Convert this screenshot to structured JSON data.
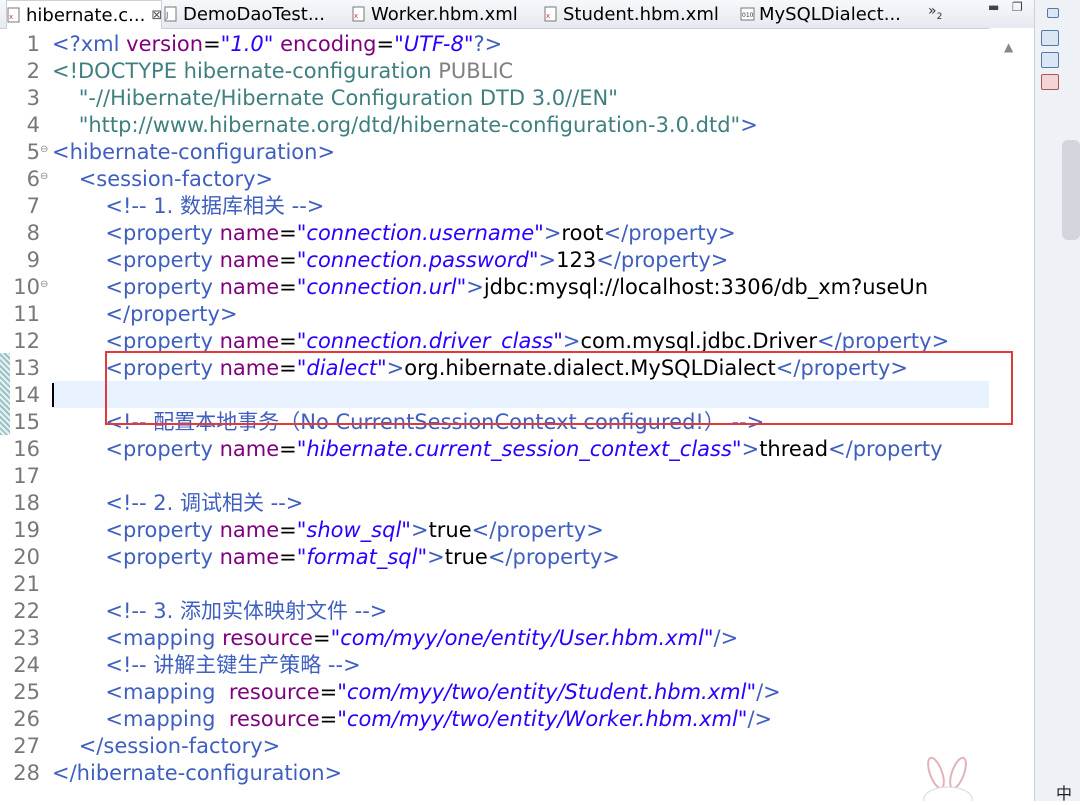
{
  "tabs": [
    {
      "label": "hibernate.c...",
      "close": "⊠",
      "active": true
    },
    {
      "label": "DemoDaoTest...",
      "active": false
    },
    {
      "label": "Worker.hbm.xml",
      "active": false
    },
    {
      "label": "Student.hbm.xml",
      "active": false
    },
    {
      "label": "MySQLDialect...",
      "active": false
    }
  ],
  "tab_overflow": "»",
  "tab_overflow_count": "2",
  "line_numbers": [
    "1",
    "2",
    "3",
    "4",
    "5",
    "6",
    "7",
    "8",
    "9",
    "10",
    "11",
    "12",
    "13",
    "14",
    "15",
    "16",
    "17",
    "18",
    "19",
    "20",
    "21",
    "22",
    "23",
    "24",
    "25",
    "26",
    "27",
    "28"
  ],
  "code": {
    "l1": {
      "a": "<?xml ",
      "b": "version",
      "c": "=",
      "d": "\"1.0\"",
      "e": " encoding",
      "f": "=",
      "g": "\"UTF-8\"",
      "h": "?>"
    },
    "l2": {
      "a": "<!DOCTYPE hibernate-configuration ",
      "b": "PUBLIC"
    },
    "l3": {
      "a": "    \"-//Hibernate/Hibernate Configuration DTD 3.0//EN\""
    },
    "l4": {
      "a": "    \"http://www.hibernate.org/dtd/hibernate-configuration-3.0.dtd\"",
      "b": ">"
    },
    "l5": {
      "a": "<hibernate-configuration>"
    },
    "l6": {
      "a": "    <session-factory>"
    },
    "l7": {
      "a": "        <!-- 1. 数据库相关 -->"
    },
    "l8": {
      "open": "        <property ",
      "attr": "name",
      "eq": "=",
      "val": "\"connection.username\"",
      "close": ">",
      "text": "root",
      "end": "</property>"
    },
    "l9": {
      "open": "        <property ",
      "attr": "name",
      "eq": "=",
      "val": "\"connection.password\"",
      "close": ">",
      "text": "123",
      "end": "</property>"
    },
    "l10": {
      "open": "        <property ",
      "attr": "name",
      "eq": "=",
      "val": "\"connection.url\"",
      "close": ">",
      "text": "jdbc:mysql://localhost:3306/db_xm?useUn"
    },
    "l11": {
      "a": "        </property>"
    },
    "l12": {
      "open": "        <property ",
      "attr": "name",
      "eq": "=",
      "val": "\"connection.driver_class\"",
      "close": ">",
      "text": "com.mysql.jdbc.Driver",
      "end": "</property>"
    },
    "l13": {
      "open": "        <property ",
      "attr": "name",
      "eq": "=",
      "val": "\"dialect\"",
      "close": ">",
      "text": "org.hibernate.dialect.MySQLDialect",
      "end": "</property>"
    },
    "l14": {
      "a": ""
    },
    "l15": {
      "a": "        <!-- 配置本地事务（No CurrentSessionContext configured!） -->"
    },
    "l16": {
      "open": "        <property ",
      "attr": "name",
      "eq": "=",
      "val": "\"hibernate.current_session_context_class\"",
      "close": ">",
      "text": "thread",
      "end": "</property"
    },
    "l17": {
      "a": ""
    },
    "l18": {
      "a": "        <!-- 2. 调试相关 -->"
    },
    "l19": {
      "open": "        <property ",
      "attr": "name",
      "eq": "=",
      "val": "\"show_sql\"",
      "close": ">",
      "text": "true",
      "end": "</property>"
    },
    "l20": {
      "open": "        <property ",
      "attr": "name",
      "eq": "=",
      "val": "\"format_sql\"",
      "close": ">",
      "text": "true",
      "end": "</property>"
    },
    "l21": {
      "a": ""
    },
    "l22": {
      "a": "        <!-- 3. 添加实体映射文件 -->"
    },
    "l23": {
      "open": "        <mapping ",
      "attr": "resource",
      "eq": "=",
      "val": "\"com/myy/one/entity/User.hbm.xml\"",
      "close": "/>"
    },
    "l24": {
      "a": "        <!-- 讲解主键生产策略 -->"
    },
    "l25": {
      "open": "        <mapping  ",
      "attr": "resource",
      "eq": "=",
      "val": "\"com/myy/two/entity/Student.hbm.xml\"",
      "close": "/>"
    },
    "l26": {
      "open": "        <mapping  ",
      "attr": "resource",
      "eq": "=",
      "val": "\"com/myy/two/entity/Worker.hbm.xml\"",
      "close": "/>"
    },
    "l27": {
      "a": "    </session-factory>"
    },
    "l28": {
      "a": "</hibernate-configuration>"
    }
  },
  "ime_indicator": "中",
  "colors": {
    "highlight_box": "#e03a3a",
    "current_line": "#e8f2fe",
    "tag": "#3f5fbf",
    "attr": "#7f007f",
    "value": "#2a00ff"
  }
}
